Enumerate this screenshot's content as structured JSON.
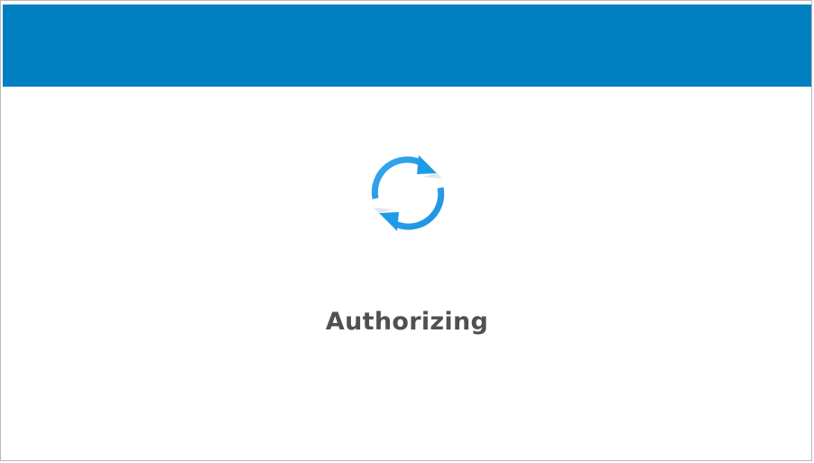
{
  "header": {
    "color": "#0080c0"
  },
  "spinner": {
    "icon": "refresh-arrows-icon",
    "color": "#1e9be8"
  },
  "status": {
    "text": "Authorizing"
  }
}
